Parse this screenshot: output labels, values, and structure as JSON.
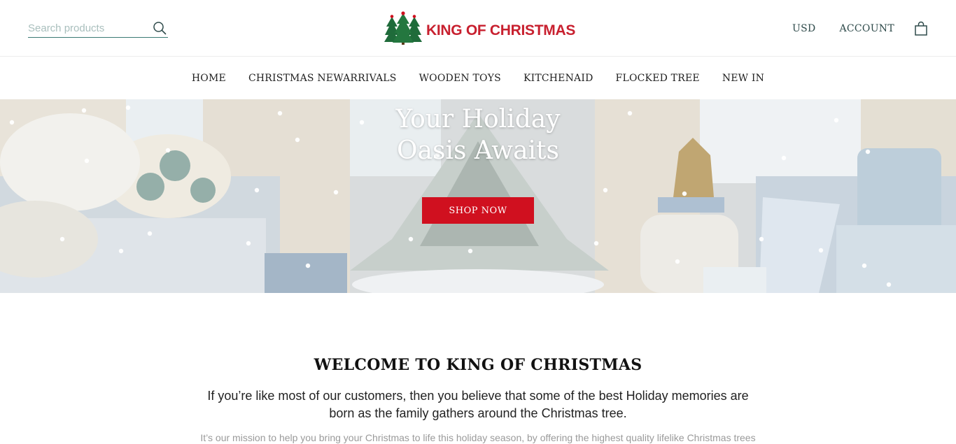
{
  "header": {
    "search": {
      "placeholder": "Search products",
      "value": ""
    },
    "logo": {
      "text": "KING OF CHRISTMAS"
    },
    "currency": "USD",
    "account": "ACCOUNT",
    "icons": {
      "search": "search-icon",
      "cart": "shopping-bag-icon",
      "logo": "christmas-trees-logo"
    }
  },
  "nav": {
    "items": [
      {
        "label": "HOME"
      },
      {
        "label": "CHRISTMAS NEWARRIVALS"
      },
      {
        "label": "WOODEN TOYS"
      },
      {
        "label": "KITCHENAID"
      },
      {
        "label": "FLOCKED TREE"
      },
      {
        "label": "NEW IN"
      }
    ]
  },
  "hero": {
    "title_line1": "Your Holiday",
    "title_line2": "Oasis Awaits",
    "button": "SHOP NOW"
  },
  "welcome": {
    "title": "WELCOME TO KING OF CHRISTMAS",
    "lead": "If you’re like most of our customers, then you believe that some of the best Holiday memories are born as the family gathers around the Christmas tree.",
    "body": "It’s our mission to help you bring your Christmas to life this holiday season, by offering the highest quality lifelike Christmas trees"
  },
  "colors": {
    "brand_red": "#c8202f",
    "button_red": "#d0101f",
    "tree_green": "#1f6b3a",
    "search_line": "#3b7a74"
  }
}
